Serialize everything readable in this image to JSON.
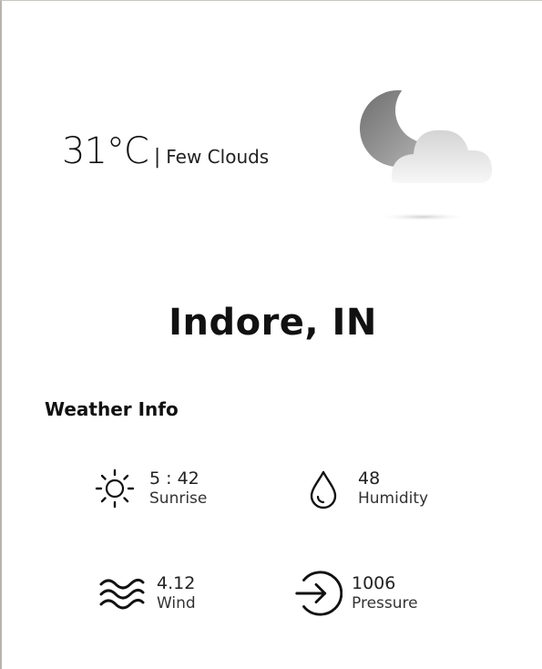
{
  "current": {
    "temperature": "31°C",
    "separator": "|",
    "condition": "Few Clouds",
    "icon": "moon-cloud-icon"
  },
  "location": {
    "city": "Indore, IN"
  },
  "weather_info": {
    "title": "Weather Info",
    "items": [
      {
        "value": "5 : 42",
        "label": "Sunrise",
        "icon": "sun-icon"
      },
      {
        "value": "48",
        "label": "Humidity",
        "icon": "droplet-icon"
      },
      {
        "value": "4.12",
        "label": "Wind",
        "icon": "wind-icon"
      },
      {
        "value": "1006",
        "label": "Pressure",
        "icon": "pressure-arrow-icon"
      }
    ]
  },
  "colors": {
    "text": "#111111",
    "icon_gray": "#8a8a8a",
    "frame_border": "#b8b3ad"
  }
}
